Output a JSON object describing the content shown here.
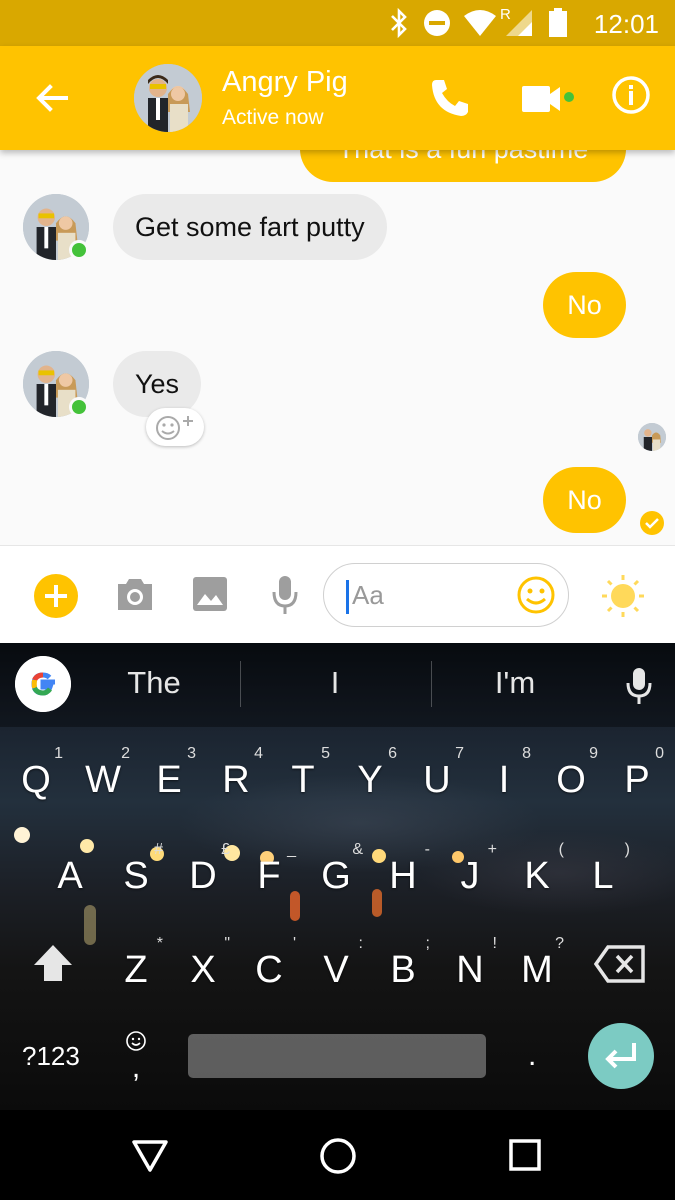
{
  "status_bar": {
    "time": "12:01",
    "icons": [
      "bluetooth-icon",
      "do-not-disturb-icon",
      "wifi-icon",
      "signal-roaming-icon",
      "battery-icon"
    ],
    "roaming_label": "R"
  },
  "header": {
    "contact_name": "Angry Pig",
    "contact_status": "Active now",
    "icons": [
      "back-arrow-icon",
      "phone-icon",
      "video-camera-icon",
      "info-icon"
    ],
    "background_color": "#ffc300"
  },
  "messages": [
    {
      "direction": "outgoing",
      "text": "That is a fun pastime",
      "partially_visible": true
    },
    {
      "direction": "incoming",
      "text": "Get some fart putty"
    },
    {
      "direction": "outgoing",
      "text": "No"
    },
    {
      "direction": "incoming",
      "text": "Yes"
    },
    {
      "direction": "outgoing",
      "text": "No",
      "status": "delivered"
    }
  ],
  "composer": {
    "placeholder": "Aa",
    "icons": [
      "plus-icon",
      "camera-icon",
      "image-icon",
      "microphone-icon",
      "emoji-icon",
      "sun-icon"
    ]
  },
  "keyboard": {
    "suggestions": [
      "The",
      "I",
      "I'm"
    ],
    "rows": [
      [
        {
          "k": "Q",
          "h": "1"
        },
        {
          "k": "W",
          "h": "2"
        },
        {
          "k": "E",
          "h": "3"
        },
        {
          "k": "R",
          "h": "4"
        },
        {
          "k": "T",
          "h": "5"
        },
        {
          "k": "Y",
          "h": "6"
        },
        {
          "k": "U",
          "h": "7"
        },
        {
          "k": "I",
          "h": "8"
        },
        {
          "k": "O",
          "h": "9"
        },
        {
          "k": "P",
          "h": "0"
        }
      ],
      [
        {
          "k": "A",
          "h": ""
        },
        {
          "k": "S",
          "h": "#"
        },
        {
          "k": "D",
          "h": "£"
        },
        {
          "k": "F",
          "h": "_"
        },
        {
          "k": "G",
          "h": "&"
        },
        {
          "k": "H",
          "h": "-"
        },
        {
          "k": "J",
          "h": "+"
        },
        {
          "k": "K",
          "h": "("
        },
        {
          "k": "L",
          "h": ")"
        }
      ],
      [
        {
          "k": "Z",
          "h": "*"
        },
        {
          "k": "X",
          "h": "\""
        },
        {
          "k": "C",
          "h": "'"
        },
        {
          "k": "V",
          "h": ":"
        },
        {
          "k": "B",
          "h": ";"
        },
        {
          "k": "N",
          "h": "!"
        },
        {
          "k": "M",
          "h": "?"
        }
      ]
    ],
    "symbols_label": "?123",
    "comma_label": ",",
    "period_label": ".",
    "enter_color": "#7ccbc3"
  },
  "nav_bar": {
    "icons": [
      "back-triangle-icon",
      "home-circle-icon",
      "recents-square-icon"
    ]
  }
}
